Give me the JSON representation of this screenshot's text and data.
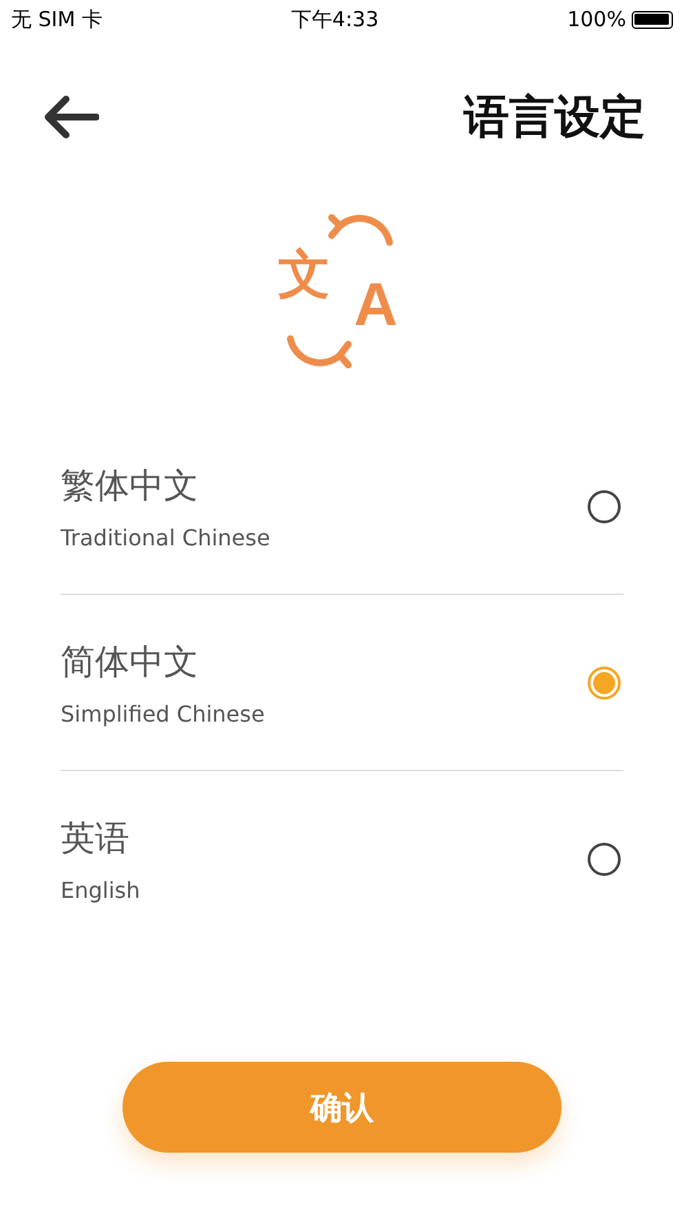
{
  "status_bar": {
    "carrier": "无 SIM 卡",
    "time": "下午4:33",
    "battery": "100%"
  },
  "header": {
    "title": "语言设定"
  },
  "hero_icon": {
    "glyphs": [
      "文",
      "A"
    ]
  },
  "languages": [
    {
      "name": "繁体中文",
      "subtitle": "Traditional Chinese",
      "selected": false
    },
    {
      "name": "简体中文",
      "subtitle": "Simplified Chinese",
      "selected": true
    },
    {
      "name": "英语",
      "subtitle": "English",
      "selected": false
    }
  ],
  "confirm_button": "确认"
}
